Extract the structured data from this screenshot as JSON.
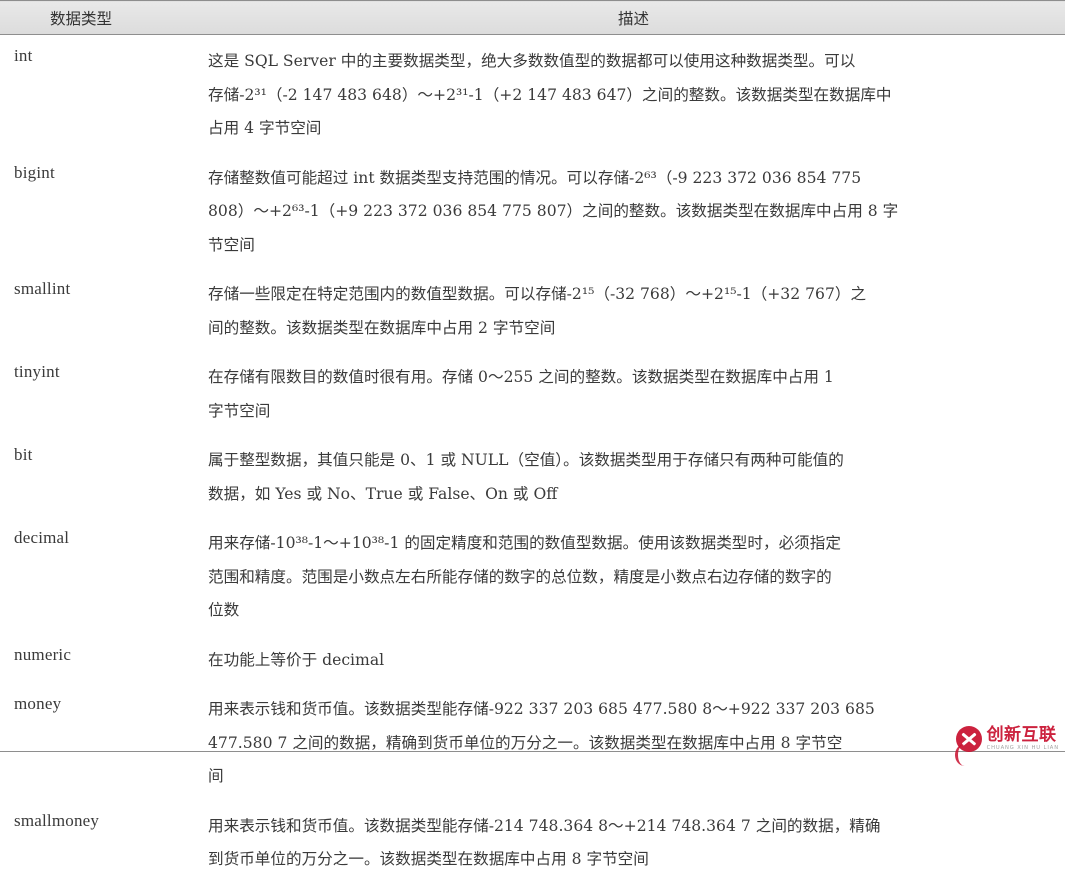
{
  "table": {
    "headers": {
      "type": "数据类型",
      "description": "描述"
    },
    "rows": [
      {
        "type": "int",
        "lines": [
          "这是 SQL Server 中的主要数据类型，绝大多数数值型的数据都可以使用这种数据类型。可以",
          "存储-2³¹（-2 147 483 648）～+2³¹-1（+2 147 483 647）之间的整数。该数据类型在数据库中",
          "占用 4 字节空间"
        ],
        "text": "这是 SQL Server 中的主要数据类型，绝大多数数值型的数据都可以使用这种数据类型。可以存储-2^31（-2 147 483 648）～+2^31-1（+2 147 483 647）之间的整数。该数据类型在数据库中占用 4 字节空间"
      },
      {
        "type": "bigint",
        "lines": [
          "存储整数值可能超过 int 数据类型支持范围的情况。可以存储-2⁶³（-9 223 372 036 854 775",
          "808）～+2⁶³-1（+9 223 372 036 854 775 807）之间的整数。该数据类型在数据库中占用 8 字",
          "节空间"
        ],
        "text": "存储整数值可能超过 int 数据类型支持范围的情况。可以存储-2^63（-9 223 372 036 854 775 808）～+2^63-1（+9 223 372 036 854 775 807）之间的整数。该数据类型在数据库中占用 8 字节空间"
      },
      {
        "type": "smallint",
        "lines": [
          "存储一些限定在特定范围内的数值型数据。可以存储-2¹⁵（-32 768）～+2¹⁵-1（+32 767）之",
          "间的整数。该数据类型在数据库中占用 2 字节空间"
        ],
        "text": "存储一些限定在特定范围内的数值型数据。可以存储-2^15（-32 768）～+2^15-1（+32 767）之间的整数。该数据类型在数据库中占用 2 字节空间"
      },
      {
        "type": "tinyint",
        "lines": [
          "在存储有限数目的数值时很有用。存储 0～255 之间的整数。该数据类型在数据库中占用 1",
          "字节空间"
        ],
        "text": "在存储有限数目的数值时很有用。存储 0～255 之间的整数。该数据类型在数据库中占用 1 字节空间"
      },
      {
        "type": "bit",
        "lines": [
          "属于整型数据，其值只能是 0、1 或 NULL（空值）。该数据类型用于存储只有两种可能值的",
          "数据，如 Yes 或 No、True 或 False、On 或 Off"
        ],
        "text": "属于整型数据，其值只能是 0、1 或 NULL（空值）。该数据类型用于存储只有两种可能值的数据，如 Yes 或 No、True 或 False、On 或 Off"
      },
      {
        "type": "decimal",
        "lines": [
          "用来存储-10³⁸-1～+10³⁸-1 的固定精度和范围的数值型数据。使用该数据类型时，必须指定",
          "范围和精度。范围是小数点左右所能存储的数字的总位数，精度是小数点右边存储的数字的",
          "位数"
        ],
        "text": "用来存储-10^38-1～+10^38-1 的固定精度和范围的数值型数据。使用该数据类型时，必须指定范围和精度。范围是小数点左右所能存储的数字的总位数，精度是小数点右边存储的数字的位数"
      },
      {
        "type": "numeric",
        "lines": [
          "在功能上等价于 decimal"
        ],
        "text": "在功能上等价于 decimal"
      },
      {
        "type": "money",
        "lines": [
          "用来表示钱和货币值。该数据类型能存储-922 337 203 685 477.580 8～+922 337 203 685",
          "477.580 7 之间的数据，精确到货币单位的万分之一。该数据类型在数据库中占用 8 字节空",
          "间"
        ],
        "text": "用来表示钱和货币值。该数据类型能存储-922 337 203 685 477.580 8～+922 337 203 685 477.580 7 之间的数据，精确到货币单位的万分之一。该数据类型在数据库中占用 8 字节空间"
      },
      {
        "type": "smallmoney",
        "lines": [
          "用来表示钱和货币值。该数据类型能存储-214 748.364 8～+214 748.364 7 之间的数据，精确",
          "到货币单位的万分之一。该数据类型在数据库中占用 8 字节空间"
        ],
        "text": "用来表示钱和货币值。该数据类型能存储-214 748.364 8～+214 748.364 7 之间的数据，精确到货币单位的万分之一。该数据类型在数据库中占用 8 字节空间"
      }
    ]
  },
  "watermark": {
    "brand_cn": "创新互联",
    "brand_pinyin": "CHUANG XIN HU LIAN"
  },
  "colors": {
    "header_bg": "#e4e4e4",
    "rule": "#8e8e8e",
    "text": "#3a3a3a",
    "watermark_red": "#c8102e"
  }
}
